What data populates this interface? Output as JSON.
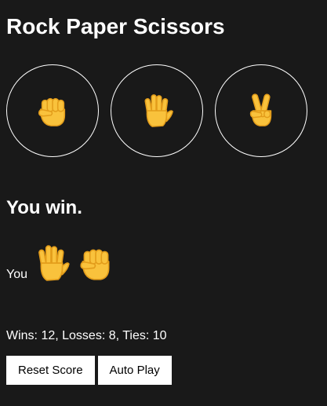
{
  "title": "Rock Paper Scissors",
  "moves": [
    {
      "name": "rock",
      "icon": "raised-fist-icon"
    },
    {
      "name": "paper",
      "icon": "raised-hand-icon"
    },
    {
      "name": "scissors",
      "icon": "victory-hand-icon"
    }
  ],
  "result_text": "You win.",
  "round": {
    "you_label": "You",
    "player_move": "paper",
    "computer_move": "rock"
  },
  "score_text": "Wins: 12, Losses: 8, Ties: 10",
  "buttons": {
    "reset": "Reset Score",
    "auto_play": "Auto Play"
  },
  "colors": {
    "background": "#191919",
    "emoji_yellow": "#F9C23C",
    "emoji_outline": "#E39D1B"
  }
}
